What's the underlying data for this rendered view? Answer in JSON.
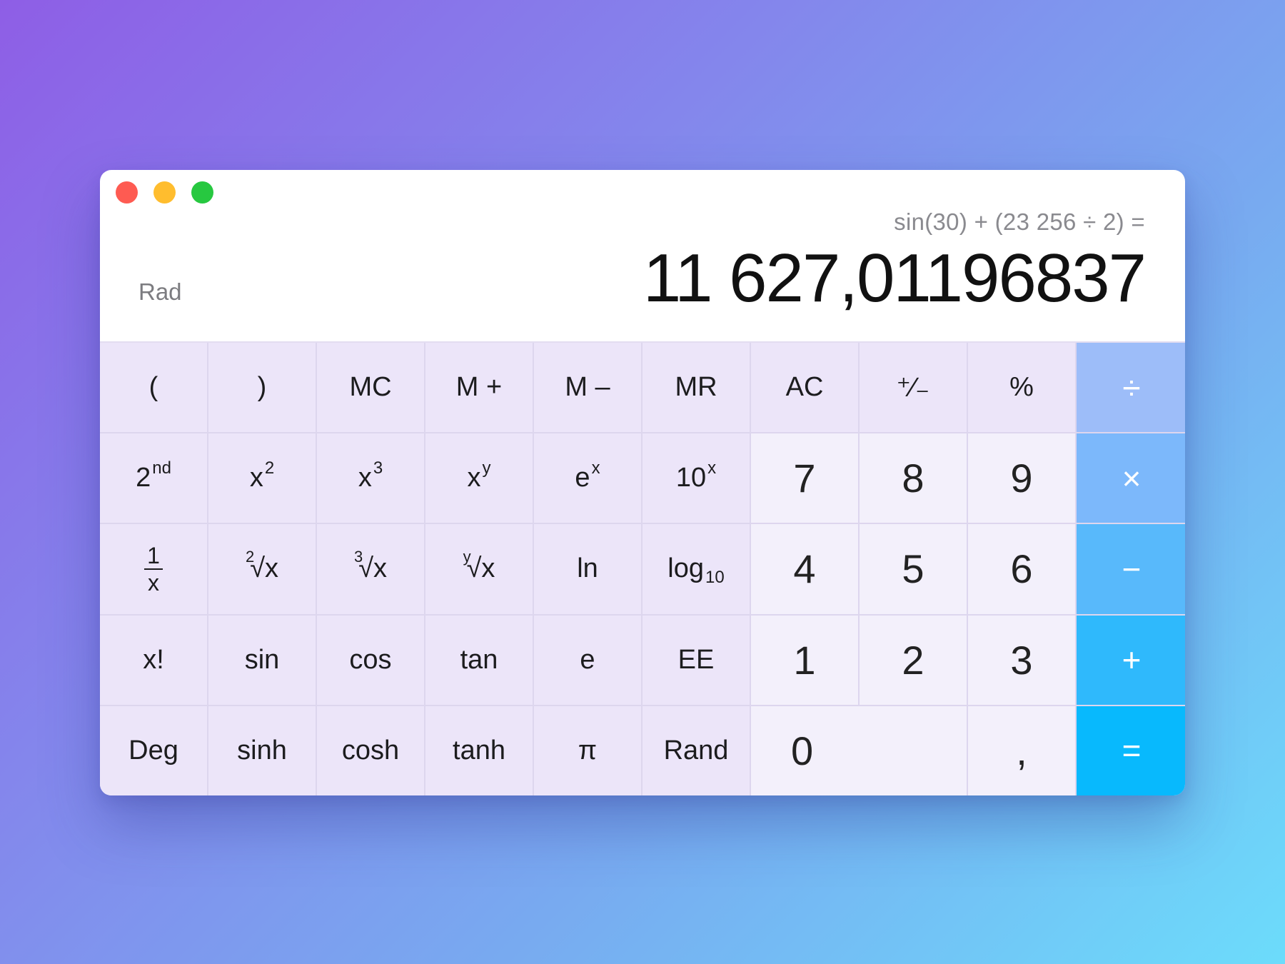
{
  "window": {
    "controls": [
      "close",
      "minimize",
      "maximize"
    ]
  },
  "display": {
    "expression": "sin(30) + (23 256 ÷ 2) =",
    "result": "11 627,01196837",
    "mode": "Rad"
  },
  "keys": {
    "row1": {
      "open_paren": "(",
      "close_paren": ")",
      "mc": "MC",
      "m_plus": "M +",
      "m_minus": "M –",
      "mr": "MR",
      "ac": "AC",
      "plus_minus": "⁺∕₋",
      "percent": "%",
      "divide": "÷"
    },
    "row2": {
      "second_base": "2",
      "second_sup": "nd",
      "x_sq_base": "x",
      "x_sq_sup": "2",
      "x_cube_base": "x",
      "x_cube_sup": "3",
      "x_y_base": "x",
      "x_y_sup": "y",
      "e_x_base": "e",
      "e_x_sup": "x",
      "ten_x_base": "10",
      "ten_x_sup": "x",
      "seven": "7",
      "eight": "8",
      "nine": "9",
      "multiply": "×"
    },
    "row3": {
      "recip_num": "1",
      "recip_den": "x",
      "sqrt_idx": "2",
      "sqrt_body": "√x",
      "cbrt_idx": "3",
      "cbrt_body": "√x",
      "yroot_idx": "y",
      "yroot_body": "√x",
      "ln": "ln",
      "log_base": "log",
      "log_sub": "10",
      "four": "4",
      "five": "5",
      "six": "6",
      "minus": "−"
    },
    "row4": {
      "factorial": "x!",
      "sin": "sin",
      "cos": "cos",
      "tan": "tan",
      "e": "e",
      "ee": "EE",
      "one": "1",
      "two": "2",
      "three": "3",
      "plus": "+"
    },
    "row5": {
      "deg": "Deg",
      "sinh": "sinh",
      "cosh": "cosh",
      "tanh": "tanh",
      "pi": "π",
      "rand": "Rand",
      "zero": "0",
      "decimal": ",",
      "equals": "="
    }
  },
  "colors": {
    "close": "#fe5b52",
    "minimize": "#ffbd2e",
    "maximize": "#27c840",
    "function_key": "#ece5f9",
    "number_key": "#f3f0fb",
    "operator_top": "#9dbdf9",
    "operator_bottom": "#08b9fd"
  }
}
